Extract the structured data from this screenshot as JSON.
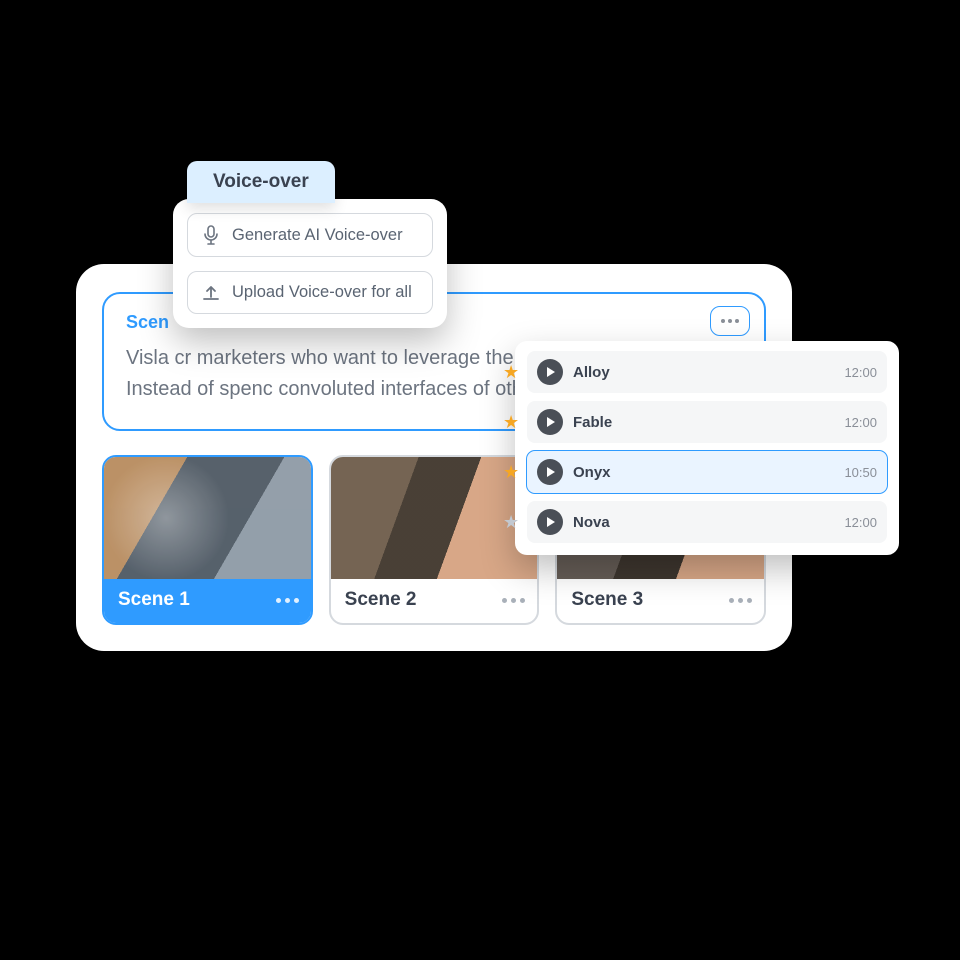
{
  "voiceover_panel": {
    "tab_label": "Voice-over",
    "generate_label": "Generate AI Voice-over",
    "upload_label": "Upload Voice-over for all"
  },
  "script": {
    "scene_label_short": "Scen",
    "body": "Visla                                                         cr              marketers who want to leverage the p                 create video content. Instead of spenc                   convoluted interfaces of other editing"
  },
  "scenes": [
    {
      "label": "Scene 1",
      "selected": true
    },
    {
      "label": "Scene 2",
      "selected": false
    },
    {
      "label": "Scene 3",
      "selected": false
    }
  ],
  "voices": [
    {
      "name": "Alloy",
      "duration": "12:00",
      "starred": true,
      "selected": false
    },
    {
      "name": "Fable",
      "duration": "12:00",
      "starred": true,
      "selected": false
    },
    {
      "name": "Onyx",
      "duration": "10:50",
      "starred": true,
      "selected": true
    },
    {
      "name": "Nova",
      "duration": "12:00",
      "starred": false,
      "selected": false
    }
  ],
  "icons": {
    "mic": "mic-icon",
    "upload": "upload-icon",
    "more": "more-icon",
    "play": "play-icon",
    "star": "star-icon"
  }
}
